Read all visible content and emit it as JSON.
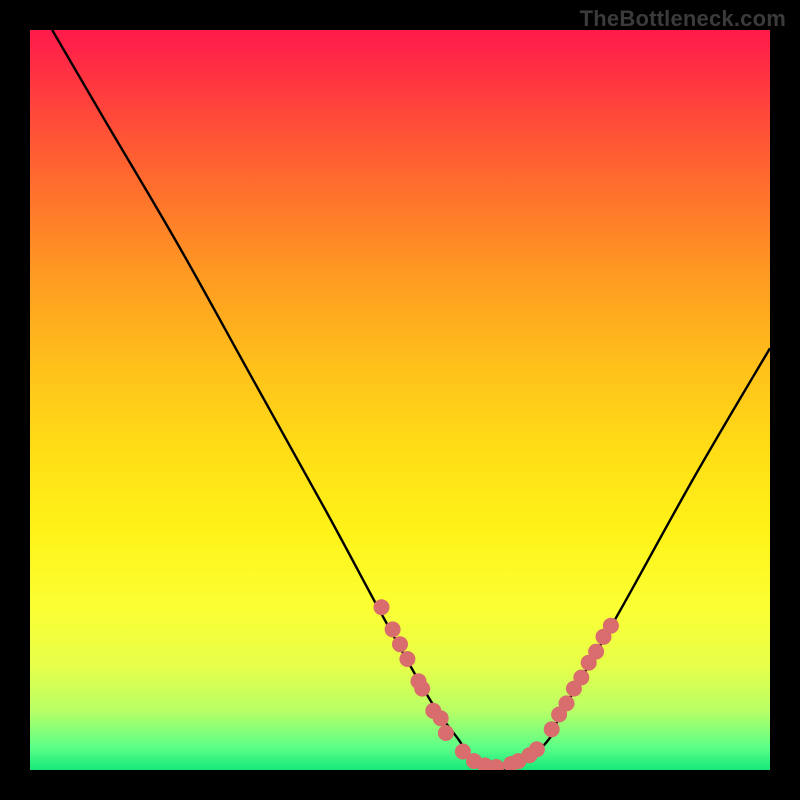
{
  "watermark": "TheBottleneck.com",
  "chart_data": {
    "type": "line",
    "title": "",
    "xlabel": "",
    "ylabel": "",
    "xlim": [
      0,
      100
    ],
    "ylim": [
      0,
      100
    ],
    "grid": false,
    "legend": false,
    "series": [
      {
        "name": "curve",
        "color": "#000000",
        "x": [
          3,
          10,
          20,
          30,
          40,
          47,
          52,
          55,
          58,
          60,
          63,
          66,
          70,
          72,
          80,
          90,
          100
        ],
        "y": [
          100,
          88,
          71,
          53,
          35,
          22,
          13,
          8,
          4,
          1,
          0,
          0.5,
          4,
          8,
          22,
          40,
          57
        ]
      }
    ],
    "markers": [
      {
        "name": "dots-left",
        "color": "#d96c6c",
        "radius": 8,
        "points": [
          {
            "x": 47.5,
            "y": 22
          },
          {
            "x": 49.0,
            "y": 19
          },
          {
            "x": 50.0,
            "y": 17
          },
          {
            "x": 51.0,
            "y": 15
          },
          {
            "x": 52.5,
            "y": 12
          },
          {
            "x": 53.0,
            "y": 11
          },
          {
            "x": 54.5,
            "y": 8
          },
          {
            "x": 55.5,
            "y": 7
          },
          {
            "x": 56.2,
            "y": 5
          }
        ]
      },
      {
        "name": "dots-bottom",
        "color": "#d96c6c",
        "radius": 8,
        "points": [
          {
            "x": 58.5,
            "y": 2.5
          },
          {
            "x": 60.0,
            "y": 1.2
          },
          {
            "x": 61.5,
            "y": 0.6
          },
          {
            "x": 63.0,
            "y": 0.4
          },
          {
            "x": 65.0,
            "y": 0.8
          },
          {
            "x": 66.0,
            "y": 1.2
          },
          {
            "x": 67.5,
            "y": 2.0
          },
          {
            "x": 68.5,
            "y": 2.8
          }
        ]
      },
      {
        "name": "dots-right",
        "color": "#d96c6c",
        "radius": 8,
        "points": [
          {
            "x": 70.5,
            "y": 5.5
          },
          {
            "x": 71.5,
            "y": 7.5
          },
          {
            "x": 72.5,
            "y": 9.0
          },
          {
            "x": 73.5,
            "y": 11.0
          },
          {
            "x": 74.5,
            "y": 12.5
          },
          {
            "x": 75.5,
            "y": 14.5
          },
          {
            "x": 76.5,
            "y": 16.0
          },
          {
            "x": 77.5,
            "y": 18.0
          },
          {
            "x": 78.5,
            "y": 19.5
          }
        ]
      }
    ],
    "background_gradient": {
      "type": "vertical",
      "stops": [
        {
          "pos": 0.0,
          "color": "#ff1a4b"
        },
        {
          "pos": 0.2,
          "color": "#ff6a2e"
        },
        {
          "pos": 0.46,
          "color": "#ffc21a"
        },
        {
          "pos": 0.78,
          "color": "#fbff33"
        },
        {
          "pos": 0.97,
          "color": "#5aff88"
        },
        {
          "pos": 1.0,
          "color": "#16e77a"
        }
      ]
    }
  }
}
